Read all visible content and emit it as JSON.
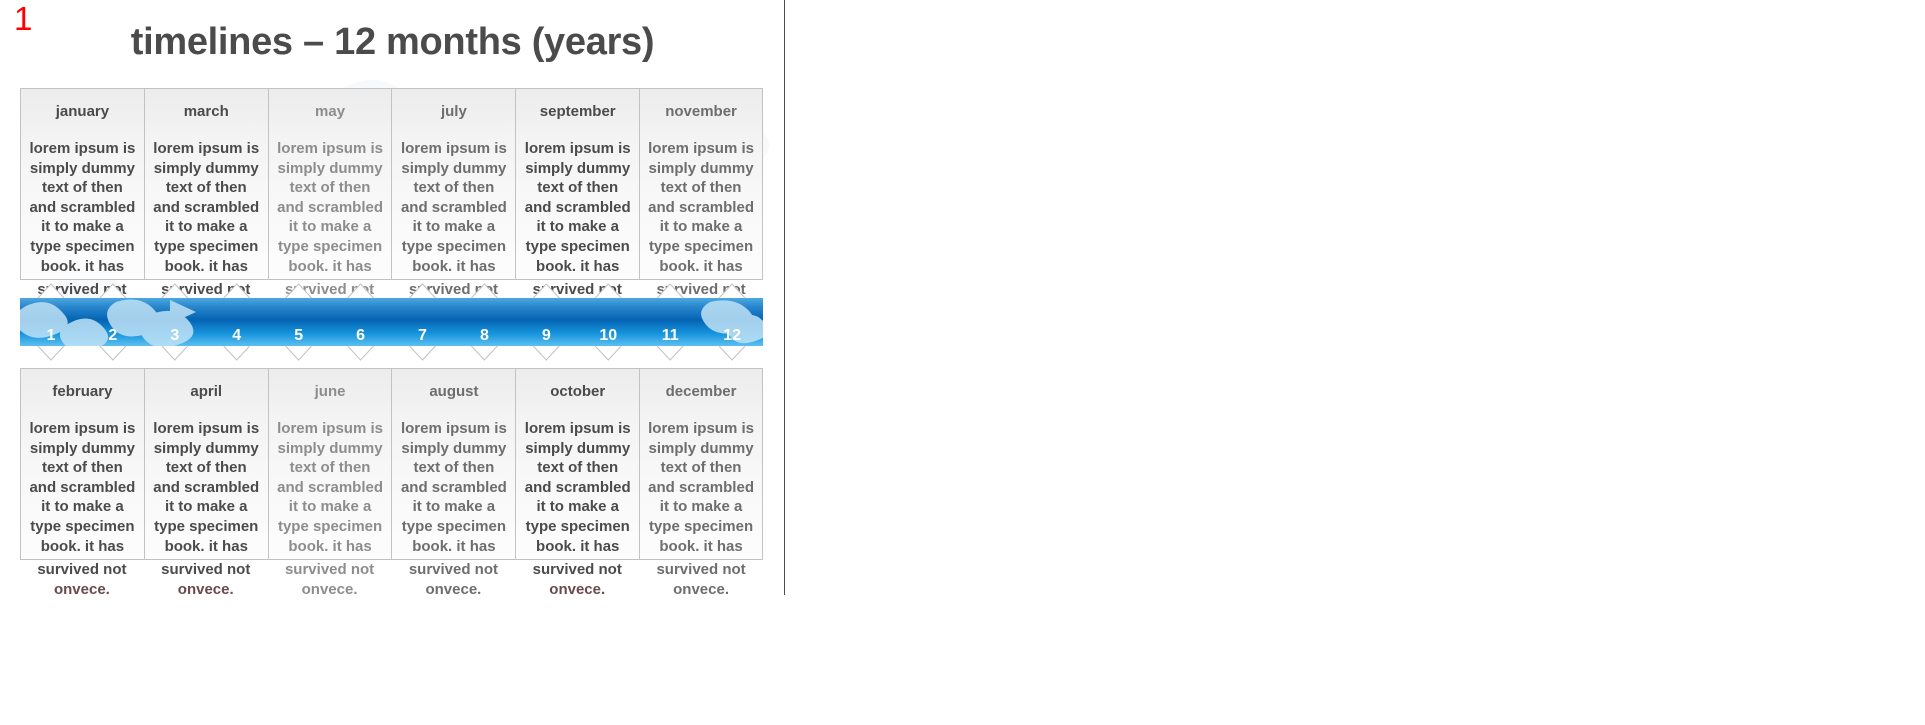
{
  "slide": {
    "number": "1",
    "number_color": "#ff0000",
    "title": "timelines – 12 months (years)",
    "accent_color": "#0a74c4",
    "text_color": "#4b4b4b"
  },
  "body_text": {
    "lines": [
      "lorem ipsum is",
      "simply dummy",
      "text of then",
      "and scrambled",
      "it to make a",
      "type specimen",
      "book. it has",
      "survived not",
      "onvece."
    ],
    "full": "lorem ipsum is simply dummy text of then and scrambled it to make a type specimen book. it has survived not onvece."
  },
  "timeline": {
    "numbers": [
      "1",
      "2",
      "3",
      "4",
      "5",
      "6",
      "7",
      "8",
      "9",
      "10",
      "11",
      "12"
    ],
    "top_months": [
      "january",
      "march",
      "may",
      "july",
      "september",
      "november"
    ],
    "bottom_months": [
      "february",
      "april",
      "june",
      "august",
      "october",
      "december"
    ]
  }
}
